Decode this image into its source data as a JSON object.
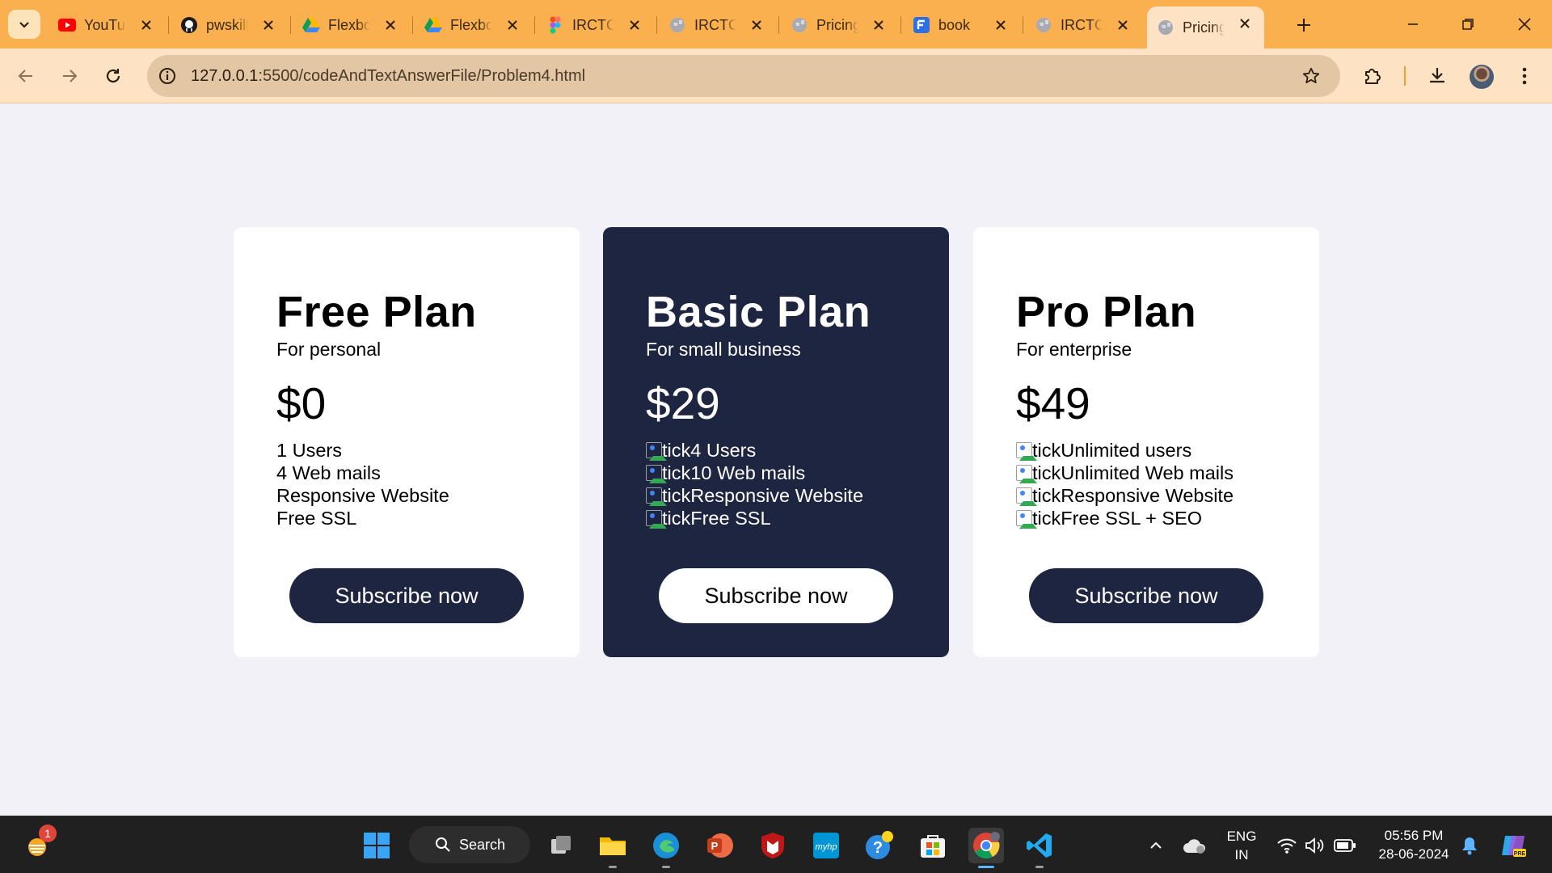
{
  "browser": {
    "tabs": [
      {
        "title": "YouTube",
        "icon": "youtube-icon"
      },
      {
        "title": "pwskills",
        "icon": "github-icon"
      },
      {
        "title": "Flexbox",
        "icon": "google-drive-icon"
      },
      {
        "title": "Flexbox",
        "icon": "google-drive-icon"
      },
      {
        "title": "IRCTC",
        "icon": "figma-icon"
      },
      {
        "title": "IRCTC",
        "icon": "globe-icon"
      },
      {
        "title": "Pricing",
        "icon": "globe-icon"
      },
      {
        "title": "book",
        "icon": "forms-icon"
      },
      {
        "title": "IRCTC",
        "icon": "globe-icon"
      },
      {
        "title": "Pricing",
        "icon": "globe-icon",
        "active": true
      }
    ],
    "url_host": "127.0.0.1",
    "url_rest": ":5500/codeAndTextAnswerFile/Problem4.html"
  },
  "plans": [
    {
      "name": "Free Plan",
      "subtitle": "For personal",
      "price": "$0",
      "features": [
        "1 Users",
        "4 Web mails",
        "Responsive Website",
        "Free SSL"
      ],
      "feature_img_alt": "",
      "button": "Subscribe now"
    },
    {
      "name": "Basic Plan",
      "subtitle": "For small business",
      "price": "$29",
      "features": [
        "4 Users",
        "10 Web mails",
        "Responsive Website",
        "Free SSL"
      ],
      "feature_img_alt": "tick",
      "button": "Subscribe now"
    },
    {
      "name": "Pro Plan",
      "subtitle": "For enterprise",
      "price": "$49",
      "features": [
        "Unlimited users",
        "Unlimited Web mails",
        "Responsive Website",
        "Free SSL + SEO"
      ],
      "feature_img_alt": "tick",
      "button": "Subscribe now"
    }
  ],
  "taskbar": {
    "search_label": "Search",
    "notification_badge": "1",
    "language": "ENG",
    "region": "IN",
    "time": "05:56 PM",
    "date": "28-06-2024"
  },
  "colors": {
    "tabstrip": "#fbb04f",
    "toolbar": "#fde3c4",
    "page_bg": "#f1f1f7",
    "featured_card": "#1e2540",
    "button_dark": "#1e2540"
  }
}
